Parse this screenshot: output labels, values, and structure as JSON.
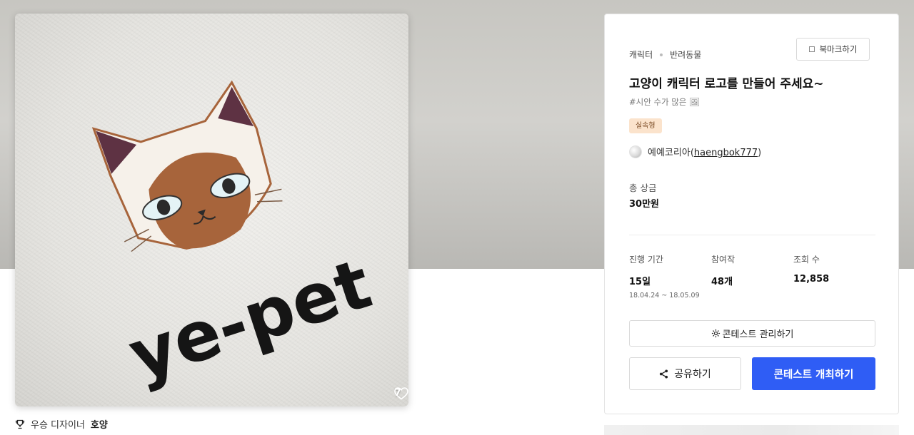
{
  "gallery": {
    "likes": "7",
    "winner_prefix": "우승 디자이너",
    "winner_name": "호양",
    "image_text": "ye-pet"
  },
  "contest": {
    "category": "캐릭터",
    "subcategory": "반려동물",
    "bookmark_label": "북마크하기",
    "title": "고양이 캐릭터 로고를 만들어 주세요~",
    "hashtag": "#시안 수가 많은 🖼",
    "type_badge": "실속형",
    "host_name": "예예코리아",
    "host_open": "(",
    "host_handle": "haengbok777",
    "host_close": ")",
    "prize_label": "총 상금",
    "prize_value": "30만원",
    "stats": {
      "duration_label": "진행 기간",
      "duration_value": "15일",
      "duration_range": "18.04.24 ~ 18.05.09",
      "entries_label": "참여작",
      "entries_value": "48개",
      "views_label": "조회 수",
      "views_value": "12,858"
    },
    "manage_label": "콘테스트 관리하기",
    "share_label": "공유하기",
    "host_label": "콘테스트 개최하기"
  },
  "colors": {
    "primary": "#2f5df5",
    "badge_bg": "#fbe3cc",
    "cat_brown": "#a7643b",
    "ear_purple": "#5e3243"
  }
}
